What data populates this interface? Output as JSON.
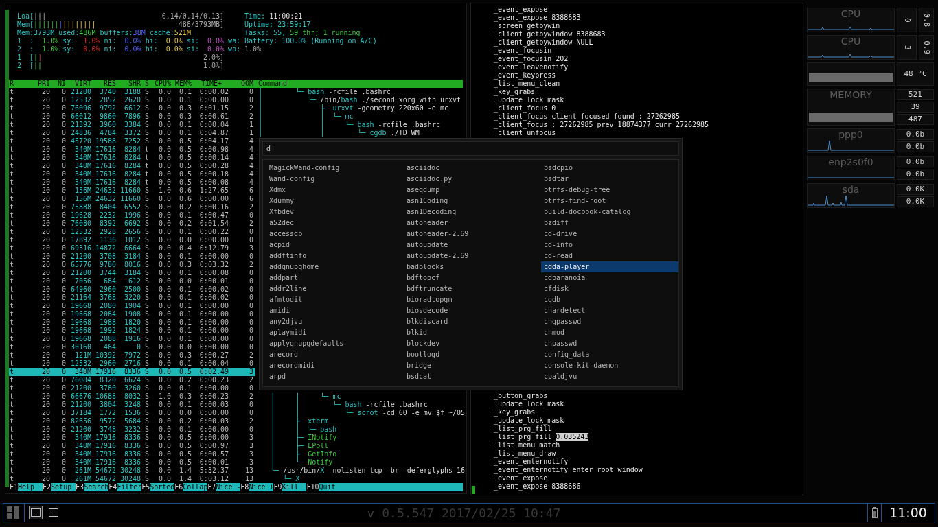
{
  "htop": {
    "header": {
      "lines": [
        {
          "left": [
            {
              "t": "Loa[",
              "kind": "label"
            },
            {
              "t": "|||",
              "kind": "dim"
            }
          ],
          "right": [
            {
              "t": "0.14/0.14/0.13]",
              "kind": "dim"
            }
          ],
          "side": [
            {
              "t": "Time: ",
              "kind": "label"
            },
            {
              "t": "11:00:21",
              "kind": "text"
            }
          ]
        },
        {
          "left": [
            {
              "t": "Mem[",
              "kind": "label"
            },
            {
              "t": "||||||",
              "kind": "green"
            },
            {
              "t": "|",
              "kind": "blue"
            },
            {
              "t": "||||||||",
              "kind": "yellow"
            }
          ],
          "right": [
            {
              "t": "486/3793MB]",
              "kind": "dim"
            }
          ],
          "side": [
            {
              "t": "Uptime: ",
              "kind": "label"
            },
            {
              "t": "23:59:17",
              "kind": "label"
            }
          ]
        },
        {
          "left": [
            {
              "t": "Mem:",
              "kind": "label"
            },
            {
              "t": "3793M",
              "kind": "label"
            },
            {
              "t": " used:",
              "kind": "label"
            },
            {
              "t": "486M",
              "kind": "green"
            },
            {
              "t": " buffers:",
              "kind": "label"
            },
            {
              "t": "38M",
              "kind": "blue"
            },
            {
              "t": " cache:",
              "kind": "label"
            },
            {
              "t": "521M",
              "kind": "yellow"
            }
          ],
          "side": [
            {
              "t": "Tasks: ",
              "kind": "label"
            },
            {
              "t": "55",
              "kind": "label"
            },
            {
              "t": ", ",
              "kind": "label"
            },
            {
              "t": "59",
              "kind": "green"
            },
            {
              "t": " thr; ",
              "kind": "green"
            },
            {
              "t": "1",
              "kind": "green"
            },
            {
              "t": " running",
              "kind": "green"
            }
          ]
        },
        {
          "left": [
            {
              "t": "1  :  ",
              "kind": "label"
            },
            {
              "t": "1.0%",
              "kind": "green"
            },
            {
              "t": " sy:  ",
              "kind": "label"
            },
            {
              "t": "1.0%",
              "kind": "red"
            },
            {
              "t": " ni:  ",
              "kind": "label"
            },
            {
              "t": "0.0%",
              "kind": "blue"
            },
            {
              "t": " hi:  ",
              "kind": "label"
            },
            {
              "t": "0.0%",
              "kind": "yellow"
            },
            {
              "t": " si:  ",
              "kind": "label"
            },
            {
              "t": "0.0%",
              "kind": "magenta"
            },
            {
              "t": " wa:",
              "kind": "label"
            }
          ],
          "side": [
            {
              "t": "Battery: 100.0% (Running on A/C)",
              "kind": "label"
            }
          ]
        },
        {
          "left": [
            {
              "t": "2  :  ",
              "kind": "label"
            },
            {
              "t": "1.0%",
              "kind": "green"
            },
            {
              "t": " sy:  ",
              "kind": "label"
            },
            {
              "t": "0.0%",
              "kind": "red"
            },
            {
              "t": " ni:  ",
              "kind": "label"
            },
            {
              "t": "0.0%",
              "kind": "blue"
            },
            {
              "t": " hi:  ",
              "kind": "label"
            },
            {
              "t": "0.0%",
              "kind": "yellow"
            },
            {
              "t": " si:  ",
              "kind": "label"
            },
            {
              "t": "0.0%",
              "kind": "magenta"
            },
            {
              "t": " wa:",
              "kind": "label"
            }
          ],
          "side": [
            {
              "t": "1.0%",
              "kind": "dim"
            }
          ]
        },
        {
          "left": [
            {
              "t": "1  [",
              "kind": "label"
            },
            {
              "t": "|",
              "kind": "green"
            },
            {
              "t": "|",
              "kind": "red"
            }
          ],
          "right": [
            {
              "t": "2.0%]",
              "kind": "dim"
            }
          ]
        },
        {
          "left": [
            {
              "t": "2  [",
              "kind": "label"
            },
            {
              "t": "||",
              "kind": "green"
            }
          ],
          "right": [
            {
              "t": "1.0%]",
              "kind": "dim"
            }
          ]
        }
      ]
    },
    "columns": [
      "R",
      "PRI",
      "NI",
      "VIRT",
      "RES",
      "SHR",
      "S",
      "CPU%",
      "MEM%",
      "TIME+",
      "OOM",
      "Command"
    ],
    "rows": [
      {
        "cells": [
          "t",
          "20",
          "0",
          "21200",
          "3740",
          "3188",
          "S",
          "0.0",
          "0.1",
          "0:00.02",
          "0"
        ],
        "selected": false,
        "command": {
          "tree": "│        └─ ",
          "name": "bash",
          "args": " -rcfile .bashrc",
          "kind": "process"
        }
      },
      {
        "cells": [
          "t",
          "20",
          "0",
          "12532",
          "2852",
          "2620",
          "S",
          "0.0",
          "0.1",
          "0:00.00",
          "0"
        ],
        "selected": false,
        "command": {
          "tree": "│           └─ ",
          "path": "/bin/",
          "name": "bash",
          "args": " ./second_xorg_with_urxvt",
          "kind": "process"
        }
      },
      {
        "cells": [
          "t",
          "20",
          "0",
          "76096",
          "9792",
          "6612",
          "S",
          "0.0",
          "0.3",
          "0:01.15",
          "2"
        ],
        "selected": false,
        "command": {
          "tree": "│              ├─ ",
          "name": "urxvt",
          "args": " -geometry 220x60 -e mc",
          "kind": "process"
        }
      },
      {
        "cells": [
          "t",
          "20",
          "0",
          "66012",
          "9860",
          "7896",
          "S",
          "0.0",
          "0.3",
          "0:00.61",
          "2"
        ],
        "selected": false,
        "command": {
          "tree": "│              │  └─ ",
          "name": "mc",
          "kind": "process"
        }
      },
      {
        "cells": [
          "t",
          "20",
          "0",
          "21392",
          "3960",
          "3384",
          "S",
          "0.0",
          "0.1",
          "0:00.04",
          "1"
        ],
        "selected": false,
        "command": {
          "tree": "│              │     └─ ",
          "name": "bash",
          "args": " -rcfile .bashrc",
          "kind": "process"
        }
      },
      {
        "cells": [
          "t",
          "20",
          "0",
          "24836",
          "4784",
          "3372",
          "S",
          "0.0",
          "0.1",
          "0:04.87",
          "1"
        ],
        "selected": false,
        "command": {
          "tree": "│              │        └─ ",
          "name": "cgdb",
          "args": " ./TD_WM",
          "kind": "process"
        }
      },
      {
        "cells": [
          "t",
          "20",
          "0",
          "45720",
          "19588",
          "7252",
          "S",
          "0.0",
          "0.5",
          "0:04.17",
          "4"
        ],
        "selected": false
      },
      {
        "cells": [
          "t",
          "20",
          "0",
          "340M",
          "17616",
          "8284",
          "t",
          "0.0",
          "0.5",
          "0:00.98",
          "4"
        ],
        "selected": false
      },
      {
        "cells": [
          "t",
          "20",
          "0",
          "340M",
          "17616",
          "8284",
          "t",
          "0.0",
          "0.5",
          "0:00.14",
          "4"
        ],
        "selected": false
      },
      {
        "cells": [
          "t",
          "20",
          "0",
          "340M",
          "17616",
          "8284",
          "t",
          "0.0",
          "0.5",
          "0:00.28",
          "4"
        ],
        "selected": false
      },
      {
        "cells": [
          "t",
          "20",
          "0",
          "340M",
          "17616",
          "8284",
          "t",
          "0.0",
          "0.5",
          "0:00.18",
          "4"
        ],
        "selected": false
      },
      {
        "cells": [
          "t",
          "20",
          "0",
          "340M",
          "17616",
          "8284",
          "t",
          "0.0",
          "0.5",
          "0:00.08",
          "4"
        ],
        "selected": false
      },
      {
        "cells": [
          "t",
          "20",
          "0",
          "156M",
          "24632",
          "11660",
          "S",
          "1.0",
          "0.6",
          "1:27.65",
          "6"
        ],
        "selected": false
      },
      {
        "cells": [
          "t",
          "20",
          "0",
          "156M",
          "24632",
          "11660",
          "S",
          "0.0",
          "0.6",
          "0:00.00",
          "6"
        ],
        "selected": false
      },
      {
        "cells": [
          "t",
          "20",
          "0",
          "75888",
          "8404",
          "6552",
          "S",
          "0.0",
          "0.2",
          "0:00.16",
          "2"
        ],
        "selected": false
      },
      {
        "cells": [
          "t",
          "20",
          "0",
          "19628",
          "2232",
          "1996",
          "S",
          "0.0",
          "0.1",
          "0:00.47",
          "0"
        ],
        "selected": false
      },
      {
        "cells": [
          "t",
          "20",
          "0",
          "76080",
          "8392",
          "6692",
          "S",
          "0.0",
          "0.2",
          "0:01.54",
          "2"
        ],
        "selected": false
      },
      {
        "cells": [
          "t",
          "20",
          "0",
          "12532",
          "2928",
          "2656",
          "S",
          "0.0",
          "0.1",
          "0:00.22",
          "0"
        ],
        "selected": false
      },
      {
        "cells": [
          "t",
          "20",
          "0",
          "17892",
          "1136",
          "1012",
          "S",
          "0.0",
          "0.0",
          "0:00.00",
          "0"
        ],
        "selected": false
      },
      {
        "cells": [
          "t",
          "20",
          "0",
          "69316",
          "14872",
          "6664",
          "S",
          "0.0",
          "0.4",
          "0:12.79",
          "3"
        ],
        "selected": false
      },
      {
        "cells": [
          "t",
          "20",
          "0",
          "21200",
          "3708",
          "3184",
          "S",
          "0.0",
          "0.1",
          "0:00.00",
          "0"
        ],
        "selected": false
      },
      {
        "cells": [
          "t",
          "20",
          "0",
          "65776",
          "9780",
          "8016",
          "S",
          "0.0",
          "0.3",
          "0:03.32",
          "2"
        ],
        "selected": false
      },
      {
        "cells": [
          "t",
          "20",
          "0",
          "21200",
          "3744",
          "3184",
          "S",
          "0.0",
          "0.1",
          "0:00.08",
          "0"
        ],
        "selected": false
      },
      {
        "cells": [
          "t",
          "20",
          "0",
          "7056",
          "684",
          "612",
          "S",
          "0.0",
          "0.0",
          "0:00.01",
          "0"
        ],
        "selected": false
      },
      {
        "cells": [
          "t",
          "20",
          "0",
          "64960",
          "2960",
          "2500",
          "S",
          "0.0",
          "0.1",
          "0:00.02",
          "0"
        ],
        "selected": false
      },
      {
        "cells": [
          "t",
          "20",
          "0",
          "21164",
          "3768",
          "3220",
          "S",
          "0.0",
          "0.1",
          "0:00.02",
          "0"
        ],
        "selected": false
      },
      {
        "cells": [
          "t",
          "20",
          "0",
          "19668",
          "2080",
          "1904",
          "S",
          "0.0",
          "0.1",
          "0:00.00",
          "0"
        ],
        "selected": false
      },
      {
        "cells": [
          "t",
          "20",
          "0",
          "19668",
          "2084",
          "1908",
          "S",
          "0.0",
          "0.1",
          "0:00.00",
          "0"
        ],
        "selected": false
      },
      {
        "cells": [
          "t",
          "20",
          "0",
          "19668",
          "1988",
          "1820",
          "S",
          "0.0",
          "0.1",
          "0:00.00",
          "0"
        ],
        "selected": false
      },
      {
        "cells": [
          "t",
          "20",
          "0",
          "19668",
          "1992",
          "1824",
          "S",
          "0.0",
          "0.1",
          "0:00.00",
          "0"
        ],
        "selected": false
      },
      {
        "cells": [
          "t",
          "20",
          "0",
          "19668",
          "2088",
          "1916",
          "S",
          "0.0",
          "0.1",
          "0:00.00",
          "0"
        ],
        "selected": false
      },
      {
        "cells": [
          "t",
          "20",
          "0",
          "30160",
          "464",
          "0",
          "S",
          "0.0",
          "0.0",
          "0:00.00",
          "0"
        ],
        "selected": false
      },
      {
        "cells": [
          "t",
          "20",
          "0",
          "121M",
          "10392",
          "7972",
          "S",
          "0.0",
          "0.3",
          "0:00.27",
          "2"
        ],
        "selected": false
      },
      {
        "cells": [
          "t",
          "20",
          "0",
          "12532",
          "2960",
          "2716",
          "S",
          "0.0",
          "0.1",
          "0:00.04",
          "0"
        ],
        "selected": false
      },
      {
        "cells": [
          "t",
          "20",
          "0",
          "340M",
          "17916",
          "8336",
          "S",
          "0.0",
          "0.5",
          "0:02.49",
          "3"
        ],
        "selected": true
      },
      {
        "cells": [
          "t",
          "20",
          "0",
          "76084",
          "8320",
          "6624",
          "S",
          "0.0",
          "0.2",
          "0:00.23",
          "2"
        ],
        "selected": false
      },
      {
        "cells": [
          "t",
          "20",
          "0",
          "21200",
          "3780",
          "3260",
          "S",
          "0.0",
          "0.1",
          "0:00.00",
          "0"
        ],
        "selected": false
      },
      {
        "cells": [
          "t",
          "20",
          "0",
          "66676",
          "10688",
          "8032",
          "S",
          "1.0",
          "0.3",
          "0:00.23",
          "2"
        ],
        "selected": false,
        "command": {
          "tree": "   │     │     └─ ",
          "name": "mc",
          "kind": "process"
        }
      },
      {
        "cells": [
          "t",
          "20",
          "0",
          "21200",
          "3804",
          "3248",
          "S",
          "0.0",
          "0.1",
          "0:00.03",
          "0"
        ],
        "selected": false,
        "command": {
          "tree": "   │     │        └─ ",
          "name": "bash",
          "args": " -rcfile .bashrc",
          "kind": "process"
        }
      },
      {
        "cells": [
          "t",
          "20",
          "0",
          "37184",
          "1772",
          "1536",
          "S",
          "0.0",
          "0.0",
          "0:00.00",
          "0"
        ],
        "selected": false,
        "command": {
          "tree": "   │     │           └─ ",
          "name": "scrot",
          "args": " -cd 60 -e mv $f ~/05",
          "kind": "process"
        }
      },
      {
        "cells": [
          "t",
          "20",
          "0",
          "82656",
          "9572",
          "5684",
          "S",
          "0.0",
          "0.2",
          "0:00.03",
          "2"
        ],
        "selected": false,
        "command": {
          "tree": "   │     ├─ ",
          "name": "xterm",
          "kind": "process"
        }
      },
      {
        "cells": [
          "t",
          "20",
          "0",
          "21200",
          "3748",
          "3232",
          "S",
          "0.0",
          "0.1",
          "0:00.00",
          "0"
        ],
        "selected": false,
        "command": {
          "tree": "   │     │  └─ ",
          "name": "bash",
          "kind": "process"
        }
      },
      {
        "cells": [
          "t",
          "20",
          "0",
          "340M",
          "17916",
          "8336",
          "S",
          "0.0",
          "0.5",
          "0:00.00",
          "3"
        ],
        "selected": false,
        "command": {
          "tree": "   │     ├─ ",
          "name": "INotify",
          "kind": "thread"
        }
      },
      {
        "cells": [
          "t",
          "20",
          "0",
          "340M",
          "17916",
          "8336",
          "S",
          "0.0",
          "0.5",
          "0:00.97",
          "3"
        ],
        "selected": false,
        "command": {
          "tree": "   │     ├─ ",
          "name": "EPoll",
          "kind": "thread"
        }
      },
      {
        "cells": [
          "t",
          "20",
          "0",
          "340M",
          "17916",
          "8336",
          "S",
          "0.0",
          "0.5",
          "0:00.57",
          "3"
        ],
        "selected": false,
        "command": {
          "tree": "   │     ├─ ",
          "name": "GetInfo",
          "kind": "thread"
        }
      },
      {
        "cells": [
          "t",
          "20",
          "0",
          "340M",
          "17916",
          "8336",
          "S",
          "0.0",
          "0.5",
          "0:00.01",
          "3"
        ],
        "selected": false,
        "command": {
          "tree": "   │     └─ ",
          "name": "Notify",
          "kind": "thread"
        }
      },
      {
        "cells": [
          "t",
          "20",
          "0",
          "261M",
          "54672",
          "30248",
          "S",
          "0.0",
          "1.4",
          "5:32.37",
          "13"
        ],
        "selected": false,
        "command": {
          "tree": "   └─ ",
          "path": "/usr/bin/",
          "name": "X",
          "args": " -nolisten tcp -br -deferglyphs 16",
          "kind": "process"
        }
      },
      {
        "cells": [
          "t",
          "20",
          "0",
          "261M",
          "54672",
          "30248",
          "S",
          "0.0",
          "1.4",
          "0:03.12",
          "13"
        ],
        "selected": false,
        "command": {
          "tree": "      └─ ",
          "name": "X",
          "kind": "process"
        }
      }
    ],
    "function_keys": [
      {
        "key": "F1",
        "label": "Help"
      },
      {
        "key": "F2",
        "label": "Setup"
      },
      {
        "key": "F3",
        "label": "Search"
      },
      {
        "key": "F4",
        "label": "Filter"
      },
      {
        "key": "F5",
        "label": "Sorted"
      },
      {
        "key": "F6",
        "label": "Collap"
      },
      {
        "key": "F7",
        "label": "Nice -"
      },
      {
        "key": "F8",
        "label": "Nice +"
      },
      {
        "key": "F9",
        "label": "Kill"
      },
      {
        "key": "F10",
        "label": "Quit"
      }
    ]
  },
  "log": {
    "top": [
      {
        "text": "_event_expose"
      },
      {
        "text": "_event_expose 8388683"
      },
      {
        "text": "_screen_getbywin"
      },
      {
        "text": "_client_getbywindow 8388683"
      },
      {
        "text": "_client_getbywindow NULL"
      },
      {
        "text": "_event_focusin"
      },
      {
        "text": "_event_focusin 202"
      },
      {
        "text": "_event_leavenotify"
      },
      {
        "text": "_event_keypress"
      },
      {
        "text": "_list_menu_clean"
      },
      {
        "text": "_key_grabs"
      },
      {
        "text": "_update_lock_mask"
      },
      {
        "text": "_client_focus 0"
      },
      {
        "text": "_client_focus client focused found : 27262985"
      },
      {
        "text": "_client_focus : 27262985 prev 18874377 curr 27262985"
      },
      {
        "text": "_client_unfocus"
      }
    ],
    "bottom": [
      {
        "text": "_button_grabs"
      },
      {
        "text": "_update_lock_mask"
      },
      {
        "text": "_key_grabs"
      },
      {
        "text": "_update_lock_mask"
      },
      {
        "text": "_list_prg_fill"
      },
      {
        "text": "_list_prg_fill ",
        "selection": "0.035243"
      },
      {
        "text": "_list_menu_match"
      },
      {
        "text": "_list_menu_draw"
      },
      {
        "text": "_event_enternotify"
      },
      {
        "text": "_event_enternotify enter root window"
      },
      {
        "text": "_event_expose"
      },
      {
        "text": "_event_expose 8388686"
      }
    ]
  },
  "launcher": {
    "query": "d",
    "columns": [
      [
        {
          "label": "MagickWand-config",
          "selected": false
        },
        {
          "label": "Wand-config",
          "selected": false
        },
        {
          "label": "Xdmx",
          "selected": false
        },
        {
          "label": "Xdummy",
          "selected": false
        },
        {
          "label": "Xfbdev",
          "selected": false
        },
        {
          "label": "a52dec",
          "selected": false
        },
        {
          "label": "accessdb",
          "selected": false
        },
        {
          "label": "acpid",
          "selected": false
        },
        {
          "label": "addftinfo",
          "selected": false
        },
        {
          "label": "addgnupghome",
          "selected": false
        },
        {
          "label": "addpart",
          "selected": false
        },
        {
          "label": "addr2line",
          "selected": false
        },
        {
          "label": "afmtodit",
          "selected": false
        },
        {
          "label": "amidi",
          "selected": false
        },
        {
          "label": "any2djvu",
          "selected": false
        },
        {
          "label": "aplaymidi",
          "selected": false
        },
        {
          "label": "applygnupgdefaults",
          "selected": false
        },
        {
          "label": "arecord",
          "selected": false
        },
        {
          "label": "arecordmidi",
          "selected": false
        },
        {
          "label": "arpd",
          "selected": false
        }
      ],
      [
        {
          "label": "asciidoc",
          "selected": false
        },
        {
          "label": "asciidoc.py",
          "selected": false
        },
        {
          "label": "aseqdump",
          "selected": false
        },
        {
          "label": "asn1Coding",
          "selected": false
        },
        {
          "label": "asn1Decoding",
          "selected": false
        },
        {
          "label": "autoheader",
          "selected": false
        },
        {
          "label": "autoheader-2.69",
          "selected": false
        },
        {
          "label": "autoupdate",
          "selected": false
        },
        {
          "label": "autoupdate-2.69",
          "selected": false
        },
        {
          "label": "badblocks",
          "selected": false
        },
        {
          "label": "bdftopcf",
          "selected": false
        },
        {
          "label": "bdftruncate",
          "selected": false
        },
        {
          "label": "bioradtopgm",
          "selected": false
        },
        {
          "label": "biosdecode",
          "selected": false
        },
        {
          "label": "blkdiscard",
          "selected": false
        },
        {
          "label": "blkid",
          "selected": false
        },
        {
          "label": "blockdev",
          "selected": false
        },
        {
          "label": "bootlogd",
          "selected": false
        },
        {
          "label": "bridge",
          "selected": false
        },
        {
          "label": "bsdcat",
          "selected": false
        }
      ],
      [
        {
          "label": "bsdcpio",
          "selected": false
        },
        {
          "label": "bsdtar",
          "selected": false
        },
        {
          "label": "btrfs-debug-tree",
          "selected": false
        },
        {
          "label": "btrfs-find-root",
          "selected": false
        },
        {
          "label": "build-docbook-catalog",
          "selected": false
        },
        {
          "label": "bzdiff",
          "selected": false
        },
        {
          "label": "cd-drive",
          "selected": false
        },
        {
          "label": "cd-info",
          "selected": false
        },
        {
          "label": "cd-read",
          "selected": false
        },
        {
          "label": "cdda-player",
          "selected": true
        },
        {
          "label": "cdparanoia",
          "selected": false
        },
        {
          "label": "cfdisk",
          "selected": false
        },
        {
          "label": "cgdb",
          "selected": false
        },
        {
          "label": "chardetect",
          "selected": false
        },
        {
          "label": "chgpasswd",
          "selected": false
        },
        {
          "label": "chmod",
          "selected": false
        },
        {
          "label": "chpasswd",
          "selected": false
        },
        {
          "label": "config_data",
          "selected": false
        },
        {
          "label": "console-kit-daemon",
          "selected": false
        },
        {
          "label": "cpaldjvu",
          "selected": false
        }
      ]
    ]
  },
  "monitor": {
    "widgets": [
      {
        "kind": "cpu",
        "label": "CPU",
        "values": [
          "0",
          "0.8"
        ]
      },
      {
        "kind": "cpu",
        "label": "CPU",
        "values": [
          "3",
          "0.9"
        ]
      },
      {
        "kind": "temp",
        "values": [
          "48 °C"
        ]
      },
      {
        "kind": "memory",
        "label": "MEMORY",
        "values": [
          "521",
          "39",
          "487"
        ]
      },
      {
        "kind": "net",
        "label": "ppp0",
        "values": [
          "0.0b",
          "0.0b"
        ]
      },
      {
        "kind": "idle",
        "label": "enp2s0f0",
        "values": [
          "0.0b",
          "0.0b"
        ]
      },
      {
        "kind": "disk",
        "label": "sda",
        "values": [
          "0.0K",
          "0.0K"
        ]
      }
    ]
  },
  "taskbar": {
    "version": "v 0.5.547 2017/02/25 10:47",
    "clock": "11:00",
    "windows": [
      {
        "selected": true
      },
      {
        "selected": false
      }
    ]
  }
}
